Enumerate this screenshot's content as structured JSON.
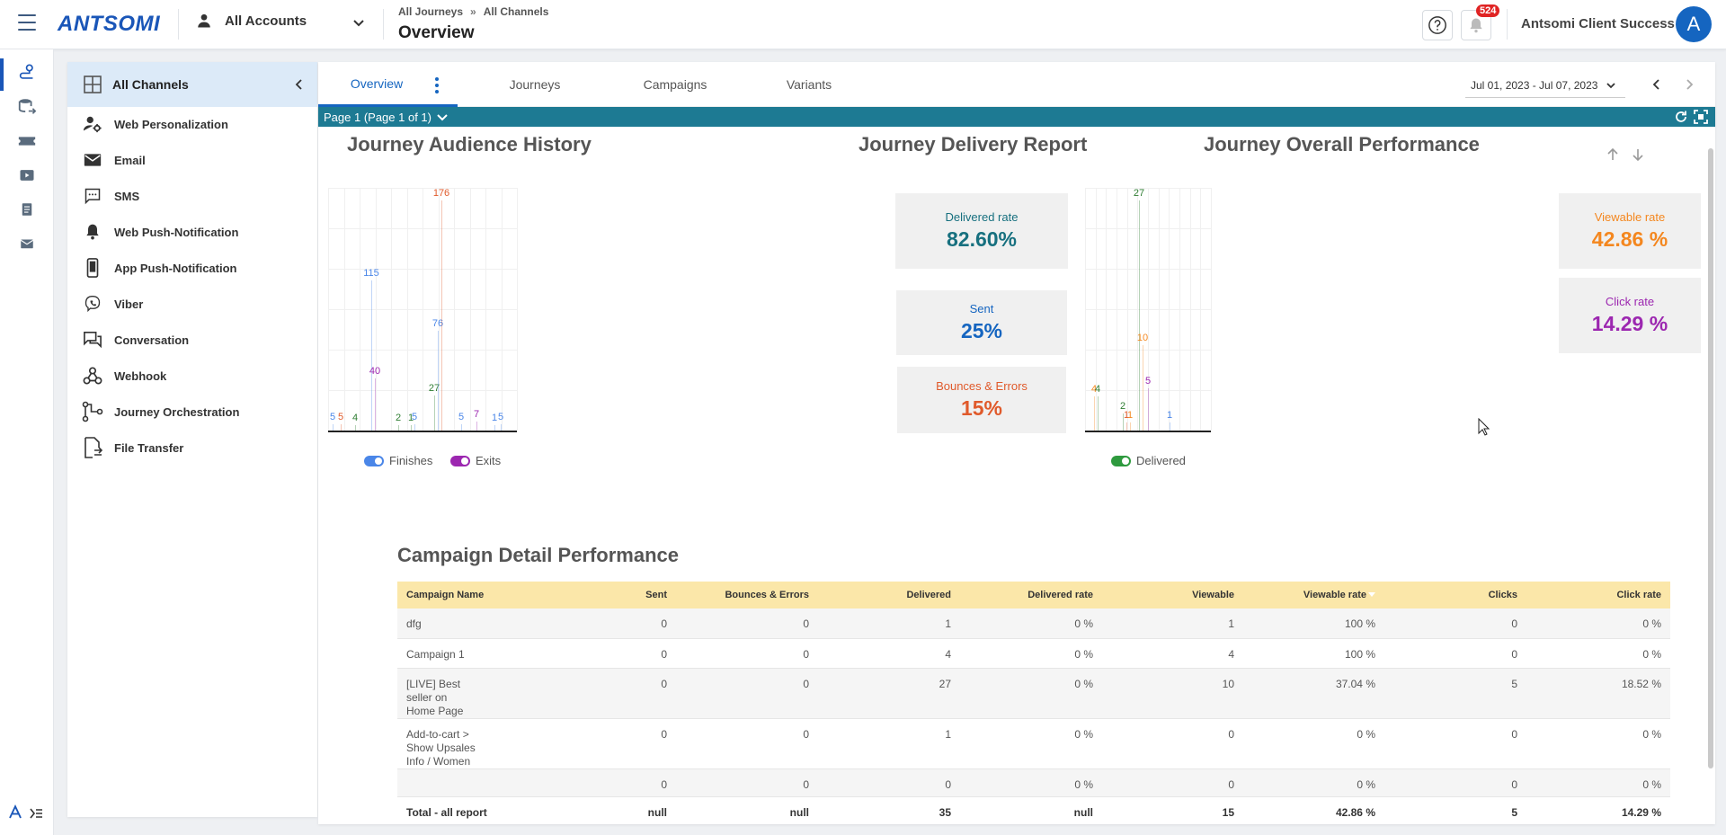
{
  "header": {
    "logo": "ANTSOMI",
    "account": "All Accounts",
    "breadcrumb": [
      "All Journeys",
      "All Channels"
    ],
    "breadcrumb_sep": "»",
    "title": "Overview",
    "notifications": "524",
    "user_name": "Antsomi Client Success",
    "avatar_letter": "A"
  },
  "rail": {
    "icons": [
      "journey-icon",
      "data-icon",
      "ticket-icon",
      "media-icon",
      "document-icon",
      "mail-icon"
    ],
    "bottom_icons": [
      "antsomi-icon",
      "expand-menu-icon"
    ]
  },
  "channels": {
    "header": "All Channels",
    "items": [
      {
        "label": "Web Personalization",
        "icon": "web-personalization-icon"
      },
      {
        "label": "Email",
        "icon": "email-icon"
      },
      {
        "label": "SMS",
        "icon": "sms-icon"
      },
      {
        "label": "Web Push-Notification",
        "icon": "bell-icon"
      },
      {
        "label": "App Push-Notification",
        "icon": "mobile-icon"
      },
      {
        "label": "Viber",
        "icon": "viber-icon"
      },
      {
        "label": "Conversation",
        "icon": "conversation-icon"
      },
      {
        "label": "Webhook",
        "icon": "webhook-icon"
      },
      {
        "label": "Journey Orchestration",
        "icon": "orchestration-icon"
      },
      {
        "label": "File Transfer",
        "icon": "file-transfer-icon"
      }
    ]
  },
  "tabs": [
    "Overview",
    "Journeys",
    "Campaigns",
    "Variants"
  ],
  "date_range": "Jul 01, 2023 - Jul 07, 2023",
  "page_selector": "Page 1 (Page 1 of 1)",
  "sections": {
    "audience": "Journey Audience History",
    "delivery": "Journey Delivery Report",
    "performance": "Journey Overall Performance",
    "campaign": "Campaign Detail Performance"
  },
  "chart_data": [
    {
      "type": "bar",
      "title": "Journey Audience History",
      "series": [
        {
          "name": "Finishes",
          "color": "#4a86e8",
          "points": [
            5,
            115,
            1,
            5,
            76,
            5,
            1,
            5
          ]
        },
        {
          "name": "Exits",
          "color": "#9c27b0",
          "points": [
            40,
            7
          ]
        }
      ],
      "other_values": [
        {
          "value": 5,
          "color": "#e05a2b"
        },
        {
          "value": 4,
          "color": "#2e7d32"
        },
        {
          "value": 2,
          "color": "#2e7d32"
        },
        {
          "value": 27,
          "color": "#2e7d32"
        },
        {
          "value": 176,
          "color": "#e05a2b"
        }
      ],
      "labels_in_order": [
        "5",
        "5",
        "4",
        "115",
        "40",
        "2",
        "1",
        "5",
        "27",
        "76",
        "176",
        "5",
        "7",
        "1",
        "5"
      ]
    },
    {
      "type": "bar",
      "title": "Journey Delivery Report",
      "series": [
        {
          "name": "Delivered",
          "color": "#2e7d32"
        }
      ],
      "labels_in_order": [
        "4",
        "4",
        "2",
        "1",
        "1",
        "27",
        "10",
        "5",
        "1"
      ]
    }
  ],
  "delivery_cards": [
    {
      "label": "Delivered rate",
      "value": "82.60%",
      "color": "#17707f",
      "label_color": "#17707f"
    },
    {
      "label": "Sent",
      "value": "25%",
      "color": "#1565c0",
      "label_color": "#1565c0"
    },
    {
      "label": "Bounces & Errors",
      "value": "15%",
      "color": "#e05a2b",
      "label_color": "#e05a2b"
    }
  ],
  "performance_cards": [
    {
      "label": "Viewable rate",
      "value": "42.86 %",
      "color": "#f4871f"
    },
    {
      "label": "Click rate",
      "value": "14.29 %",
      "color": "#9c27b0"
    }
  ],
  "table": {
    "columns": [
      "Campaign Name",
      "Sent",
      "Bounces & Errors",
      "Delivered",
      "Delivered rate",
      "Viewable",
      "Viewable rate",
      "Clicks",
      "Click rate"
    ],
    "rows": [
      [
        "dfg",
        "0",
        "0",
        "1",
        "0 %",
        "1",
        "100 %",
        "0",
        "0 %"
      ],
      [
        "Campaign 1",
        "0",
        "0",
        "4",
        "0 %",
        "4",
        "100 %",
        "0",
        "0 %"
      ],
      [
        "[LIVE] Best seller on Home Page",
        "0",
        "0",
        "27",
        "0 %",
        "10",
        "37.04 %",
        "5",
        "18.52 %"
      ],
      [
        "Add-to-cart > Show Upsales Info / Women",
        "0",
        "0",
        "1",
        "0 %",
        "0",
        "0 %",
        "0",
        "0 %"
      ],
      [
        "",
        "0",
        "0",
        "0",
        "0 %",
        "0",
        "0 %",
        "0",
        "0 %"
      ]
    ],
    "total": [
      "Total - all report",
      "null",
      "null",
      "35",
      "null",
      "15",
      "42.86 %",
      "5",
      "14.29 %"
    ]
  }
}
